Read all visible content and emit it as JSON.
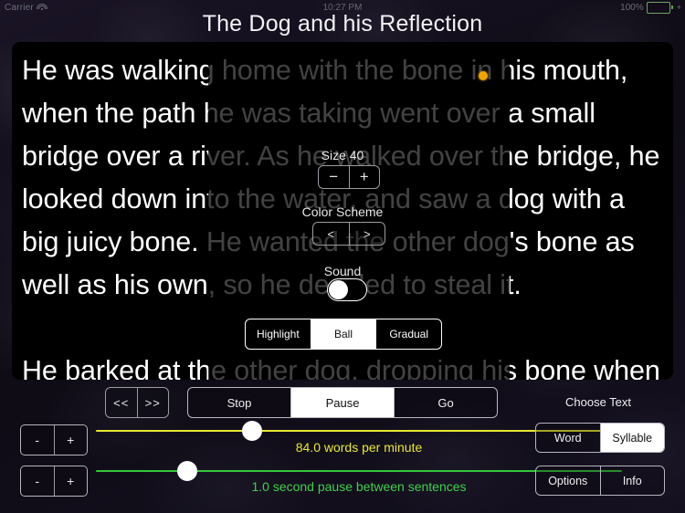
{
  "statusbar": {
    "carrier": "Carrier",
    "wifi_icon": "wifi-icon",
    "time": "10:27 PM",
    "battery_percent": "100%",
    "battery_plus": "+"
  },
  "header": {
    "title": "The Dog and his Reflection"
  },
  "reader": {
    "story_text": "He was walking home with the bone in his mouth, when the path he was taking went over a small bridge over a river. As he walked over the bridge, he looked down into the water, and saw a dog with a big juicy bone. He wanted the other dog's bone as well as his own, so he decided to steal it.\n\nHe barked at the other dog, dropping his bone when he opened his mouth. He hoped at the other dog to snatch his bone, only to find himself swimming for",
    "ball_marker": "reading-ball-marker"
  },
  "settings": {
    "size_label": "Size 40",
    "size_decrement": "−",
    "size_increment": "+",
    "color_scheme_label": "Color Scheme",
    "scheme_prev": "<",
    "scheme_next": ">",
    "sound_label": "Sound",
    "sound_on": false,
    "mode_options": [
      "Highlight",
      "Ball",
      "Gradual"
    ],
    "mode_selected": "Ball"
  },
  "transport": {
    "prev_label": "<<",
    "next_label": ">>",
    "options": [
      "Stop",
      "Pause",
      "Go"
    ],
    "selected": "Pause"
  },
  "wpm": {
    "decrement": "-",
    "increment": "+",
    "caption": "84.0 words per minute",
    "color": "#e8e832"
  },
  "pause_gap": {
    "decrement": "-",
    "increment": "+",
    "caption": "1.0 second pause between sentences",
    "color": "#3fd04a"
  },
  "right_panel": {
    "choose_text_label": "Choose Text",
    "unit_options": [
      "Word",
      "Syllable"
    ],
    "unit_selected": "Syllable",
    "aux_options": [
      "Options",
      "Info"
    ]
  }
}
